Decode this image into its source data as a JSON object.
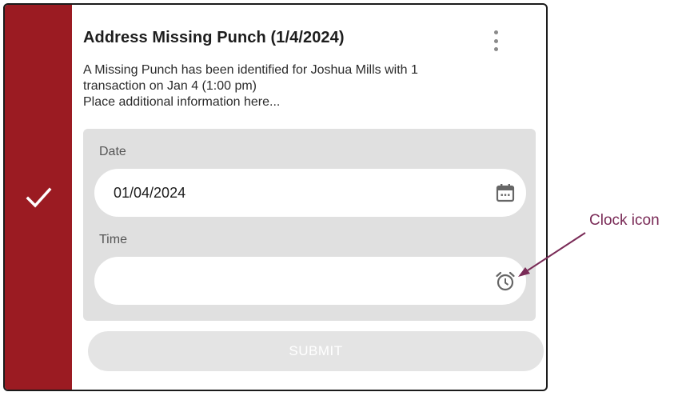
{
  "card": {
    "title": "Address Missing Punch (1/4/2024)",
    "description_lines": [
      "A Missing Punch has been identified for Joshua Mills with 1",
      "transaction on Jan 4 (1:00 pm)",
      "Place additional information here..."
    ],
    "status_icon": "checkmark-icon",
    "menu_icon": "kebab-menu-icon",
    "accent_color": "#9b1b22"
  },
  "form": {
    "date": {
      "label": "Date",
      "value": "01/04/2024",
      "icon": "calendar-icon"
    },
    "time": {
      "label": "Time",
      "value": "",
      "icon": "clock-icon"
    },
    "submit_label": "SUBMIT"
  },
  "annotation": {
    "label": "Clock icon",
    "color": "#7a2b57"
  }
}
